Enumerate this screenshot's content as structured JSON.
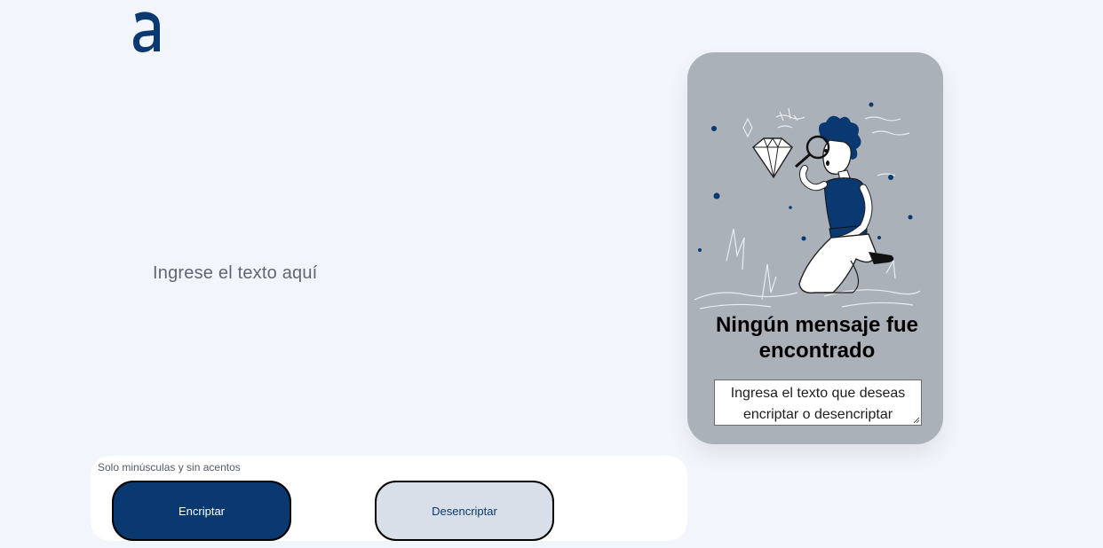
{
  "logo": {
    "icon": "alura-a-logo-icon",
    "color": "#0a3871"
  },
  "input": {
    "placeholder": "Ingrese el texto aquí"
  },
  "hint": {
    "icon": "info-icon",
    "text": "Solo minúsculas y sin acentos"
  },
  "buttons": {
    "encrypt_label": "Encriptar",
    "decrypt_label": "Desencriptar"
  },
  "output": {
    "illustration": "person-with-magnifying-glass-illustration",
    "title": "Ningún mensaje fue encontrado",
    "message": "Ingresa el texto que deseas encriptar o desencriptar"
  },
  "colors": {
    "accent": "#0a3871",
    "background": "#f2f5fc",
    "card": "#aab1b9"
  }
}
